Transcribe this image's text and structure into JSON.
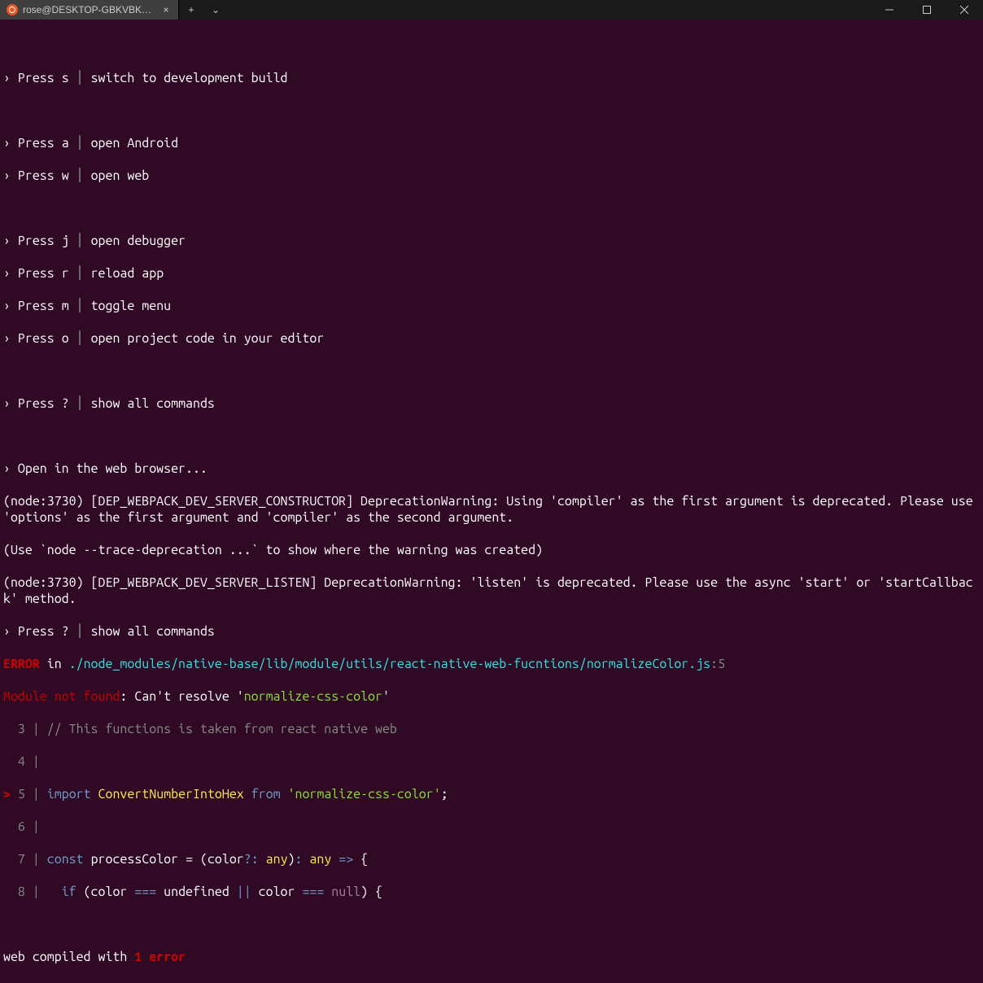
{
  "titlebar": {
    "tab_title": "rose@DESKTOP-GBKVBKH: ~/",
    "tab_close": "×",
    "new_tab": "+",
    "dropdown": "⌄"
  },
  "commands": [
    {
      "key": "s",
      "desc": "switch to development build"
    },
    {
      "key": "a",
      "desc": "open Android"
    },
    {
      "key": "w",
      "desc": "open web"
    },
    {
      "key": "j",
      "desc": "open debugger"
    },
    {
      "key": "r",
      "desc": "reload app"
    },
    {
      "key": "m",
      "desc": "toggle menu"
    },
    {
      "key": "o",
      "desc": "open project code in your editor"
    },
    {
      "key": "?",
      "desc": "show all commands"
    }
  ],
  "log": {
    "open_browser": "Open in the web browser...",
    "dep1": "(node:3730) [DEP_WEBPACK_DEV_SERVER_CONSTRUCTOR] DeprecationWarning: Using 'compiler' as the first argument is deprecated. Please use 'options' as the first argument and 'compiler' as the second argument.",
    "trace": "(Use `node --trace-deprecation ...` to show where the warning was created)",
    "dep2": "(node:3730) [DEP_WEBPACK_DEV_SERVER_LISTEN] DeprecationWarning: 'listen' is deprecated. Please use the async 'start' or 'startCallback' method.",
    "press_again_key": "?",
    "press_again_desc": "show all commands"
  },
  "error": {
    "label_error": "ERROR",
    "in": " in ",
    "file": "./node_modules/native-base/lib/module/utils/react-native-web-fucntions/normalizeColor.js",
    "loc": ":5",
    "module_not_found": "Module not found",
    "cant_resolve": ": Can't resolve '",
    "pkg": "normalize-css-color",
    "closing_quote": "'"
  },
  "code": {
    "l3": {
      "num": "3",
      "comment": "// This functions is taken from react native web"
    },
    "l4": {
      "num": "4"
    },
    "l5": {
      "num": "5",
      "import": "import",
      "ident": "ConvertNumberIntoHex",
      "from": "from",
      "pkg": "'normalize-css-color'",
      "semi": ";"
    },
    "l6": {
      "num": "6"
    },
    "l7": {
      "num": "7",
      "const": "const",
      "name": "processColor",
      "eq": " = ",
      "open": "(color",
      "qc": "?:",
      "any1": " any",
      "close_paren": ")",
      "colon": ":",
      "any2": " any ",
      "arrow": "=>",
      "brace": " {"
    },
    "l8": {
      "num": "8",
      "if": "if",
      "open": " (color ",
      "eq3a": "===",
      "undef": " undefined ",
      "or": "||",
      "mid": " color ",
      "eq3b": "===",
      "null": " null",
      "close": ") {"
    }
  },
  "footer": {
    "prefix": "web compiled with ",
    "err": "1 error"
  }
}
